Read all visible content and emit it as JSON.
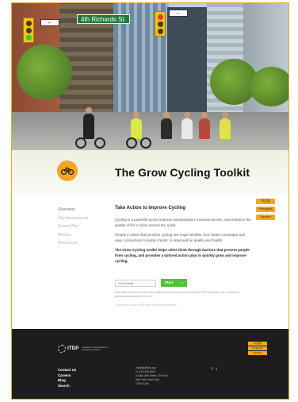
{
  "hero": {
    "street_sign": "4th Richards St."
  },
  "header": {
    "title": "The Grow Cycling Toolkit"
  },
  "sidebar": {
    "items": [
      {
        "label": "Overview",
        "active": true
      },
      {
        "label": "City Assessment",
        "active": false
      },
      {
        "label": "Action Plan",
        "active": false
      },
      {
        "label": "Metrics",
        "active": false
      },
      {
        "label": "Resources",
        "active": false
      }
    ]
  },
  "languages": [
    "中文版",
    "Português",
    "Español"
  ],
  "main": {
    "heading": "Take Action to Improve Cycling",
    "paragraph_1": "Cycling is a powerful tool to improve transportation, increase access, and enhance the quality of life in cities around the world.",
    "paragraph_2": "People in cities that prioritize cycling see huge benefits, from faster commutes and easy connections to public transit, to improved air quality and health.",
    "paragraph_3": "The Grow Cycling toolkit helps cities think through barriers that prevent people from cycling, and provides a tailored action plan to quickly grow and improve cycling."
  },
  "signup": {
    "email_placeholder": "Your Email",
    "start_label": "Start",
    "note": "Information collected as part of this toolkit will not be used by or accessible to ITDP or anyone else. Contact it is generated exclusively for the user.",
    "learn_more": "> Want to know more before getting started?"
  },
  "footer": {
    "logo_text": "ITDP",
    "logo_sub": "Institute for Transportation & Development Policy",
    "languages": [
      "中文版",
      "Português",
      "Español"
    ],
    "links": [
      "Contact Us",
      "Careers",
      "Blog",
      "Search"
    ],
    "contact": [
      "mobility@itdp.org",
      "+1-212-629-8001",
      "9 East 19th Street, 7th Floor",
      "New York, New York",
      "10003 USA"
    ],
    "social": [
      "f",
      "t"
    ]
  },
  "colors": {
    "accent": "#f5a623",
    "start_button": "#50c23c",
    "footer_bg": "#1d1d1d"
  }
}
